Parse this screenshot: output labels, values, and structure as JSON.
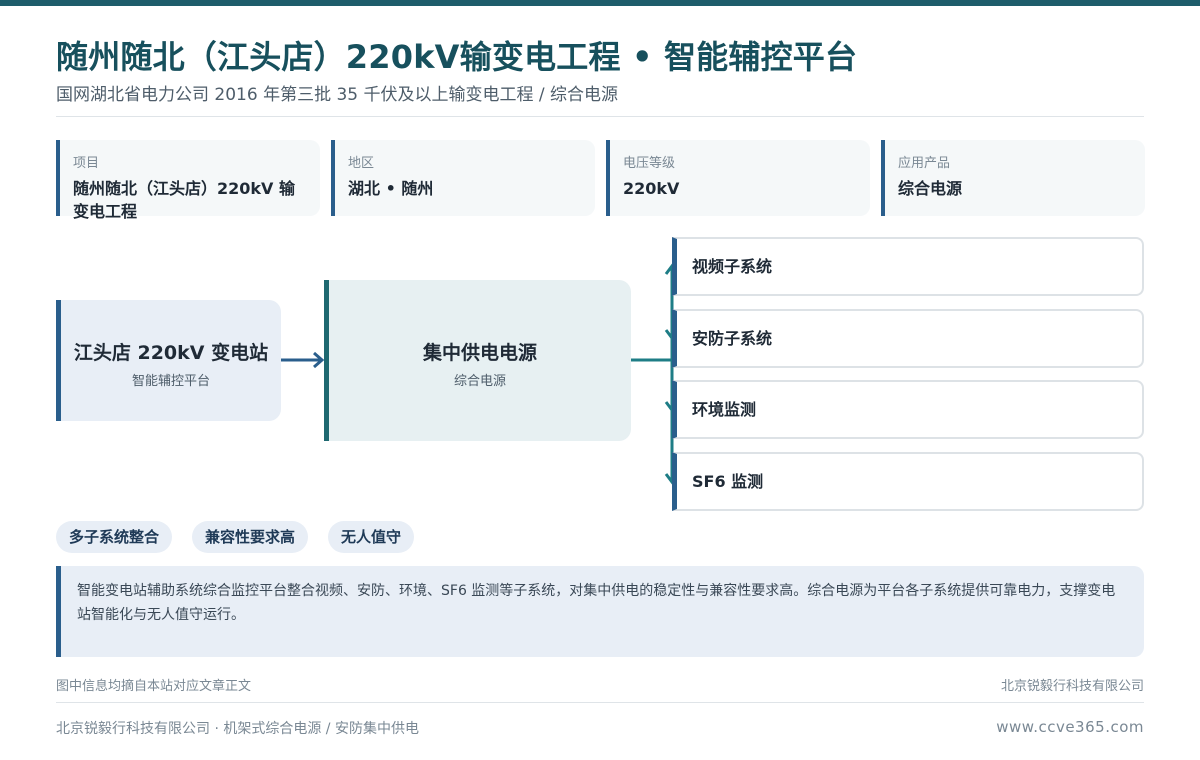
{
  "header": {
    "title": "随州随北（江头店）220kV输变电工程 • 智能辅控平台",
    "subtitle": "国网湖北省电力公司 2016 年第三批 35 千伏及以上输变电工程 / 综合电源"
  },
  "info_cards": [
    {
      "key": "项目",
      "value": "随州随北（江头店）220kV 输变电工程"
    },
    {
      "key": "地区",
      "value": "湖北 • 随州"
    },
    {
      "key": "电压等级",
      "value": "220kV"
    },
    {
      "key": "应用产品",
      "value": "综合电源"
    }
  ],
  "diagram": {
    "source": {
      "title": "江头店 220kV 变电站",
      "subtitle": "智能辅控平台"
    },
    "hub": {
      "title": "集中供电电源",
      "subtitle": "综合电源"
    },
    "subsystems": [
      "视频子系统",
      "安防子系统",
      "环境监测",
      "SF6 监测"
    ]
  },
  "tags": [
    "多子系统整合",
    "兼容性要求高",
    "无人值守"
  ],
  "description": "智能变电站辅助系统综合监控平台整合视频、安防、环境、SF6 监测等子系统，对集中供电的稳定性与兼容性要求高。综合电源为平台各子系统提供可靠电力，支撑变电站智能化与无人值守运行。",
  "footer": {
    "note_left": "图中信息均摘自本站对应文章正文",
    "note_right": "北京锐毅行科技有限公司",
    "company_line": "北京锐毅行科技有限公司 · 机架式综合电源 / 安防集中供电",
    "url": "www.ccve365.com"
  },
  "colors": {
    "accent": "#2a5e8c",
    "teal": "#1e6870",
    "title": "#17505d"
  }
}
